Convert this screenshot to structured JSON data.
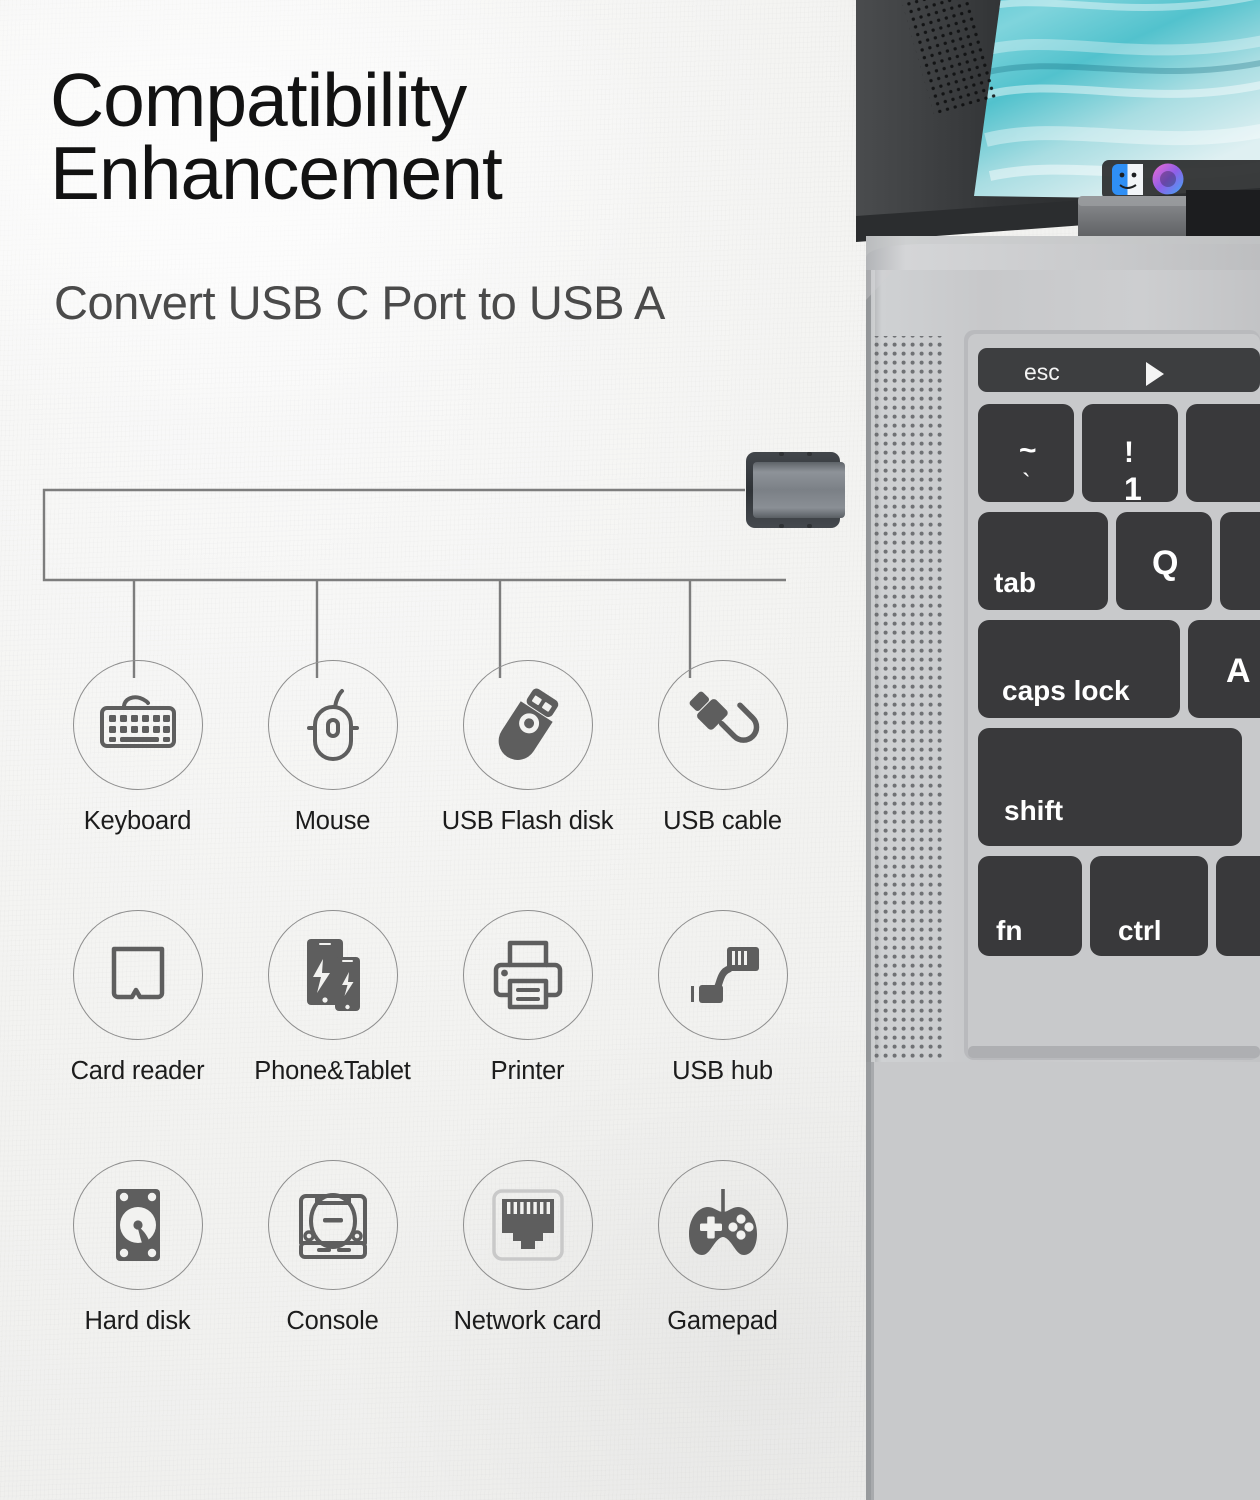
{
  "headline": {
    "line1": "Compatibility",
    "line2": "Enhancement"
  },
  "subheadline": "Convert USB C Port to USB A",
  "product": {
    "name": "usb-c-to-usb-a-adapter",
    "body_color": "#6c7075",
    "shell_color": "#3c4044",
    "connector_dot_color": "#9a9a9a"
  },
  "colors": {
    "background": "#f1f1ef",
    "headline_text": "#121212",
    "subhead_text": "#4a4a4a",
    "label_text": "#1c1c1c",
    "icon_stroke": "#5e5e5e",
    "icon_fill": "#5e5e5e",
    "circle_stroke": "#8e8e8e",
    "tree_line": "#7d7d7d",
    "laptop_silver": "#c9cacc",
    "laptop_key": "#3a3a3c",
    "screen_teal": "#2fb6c4"
  },
  "compatibility": {
    "rows": [
      [
        {
          "label": "Keyboard",
          "icon": "keyboard-icon"
        },
        {
          "label": "Mouse",
          "icon": "mouse-icon"
        },
        {
          "label": "USB Flash disk",
          "icon": "usb-flash-disk-icon"
        },
        {
          "label": "USB cable",
          "icon": "usb-cable-icon"
        }
      ],
      [
        {
          "label": "Card reader",
          "icon": "card-reader-icon"
        },
        {
          "label": "Phone&Tablet",
          "icon": "phone-tablet-icon"
        },
        {
          "label": "Printer",
          "icon": "printer-icon"
        },
        {
          "label": "USB hub",
          "icon": "usb-hub-icon"
        }
      ],
      [
        {
          "label": "Hard disk",
          "icon": "hard-disk-icon"
        },
        {
          "label": "Console",
          "icon": "console-icon"
        },
        {
          "label": "Network card",
          "icon": "network-card-icon"
        },
        {
          "label": "Gamepad",
          "icon": "gamepad-icon"
        }
      ]
    ]
  },
  "laptop": {
    "model_hint": "macbook-pro-with-touch-bar",
    "touchbar": {
      "esc_label": "esc",
      "play_icon": "play-triangle-icon"
    },
    "keys": [
      {
        "label": "~",
        "sublabel": "`"
      },
      {
        "label": "!",
        "sublabel": "1"
      },
      {
        "label": "tab"
      },
      {
        "label": "Q"
      },
      {
        "label": "caps lock"
      },
      {
        "label": "A"
      },
      {
        "label": "shift"
      },
      {
        "label": "fn"
      },
      {
        "label": "ctrl"
      }
    ],
    "screen": {
      "wallpaper": "ocean-waves-turquoise",
      "dock_icons": [
        "finder-icon",
        "siri-icon"
      ]
    }
  }
}
